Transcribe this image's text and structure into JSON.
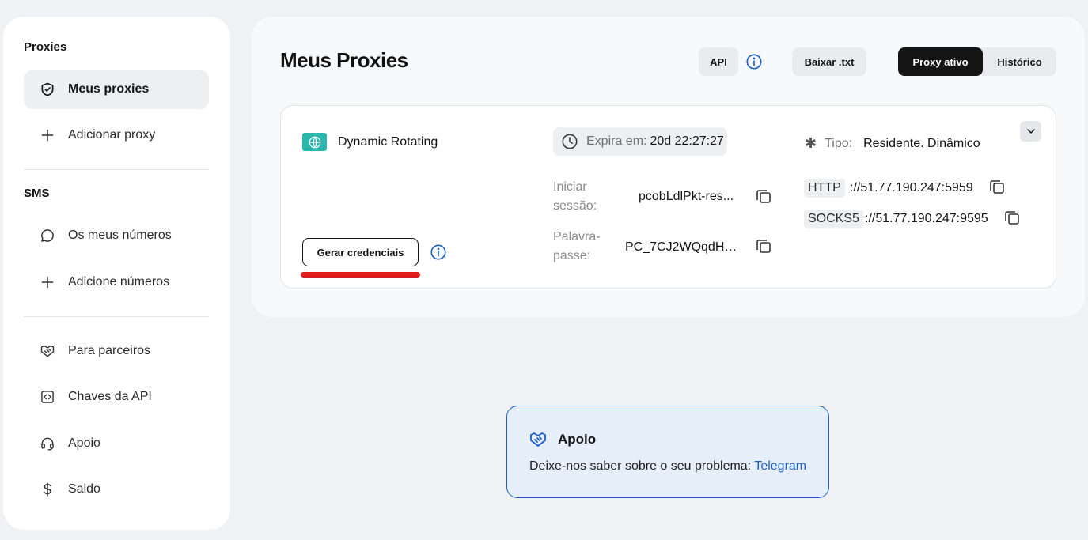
{
  "sidebar": {
    "proxies_title": "Proxies",
    "sms_title": "SMS",
    "items": [
      {
        "label": "Meus proxies",
        "icon": "shield-check-icon"
      },
      {
        "label": "Adicionar proxy",
        "icon": "plus-icon"
      },
      {
        "label": "Os meus números",
        "icon": "chat-bubble-icon"
      },
      {
        "label": "Adicione números",
        "icon": "plus-icon"
      },
      {
        "label": "Para parceiros",
        "icon": "handshake-icon"
      },
      {
        "label": "Chaves da API",
        "icon": "code-box-icon"
      },
      {
        "label": "Apoio",
        "icon": "headset-icon"
      },
      {
        "label": "Saldo",
        "icon": "dollar-icon"
      }
    ]
  },
  "header": {
    "title": "Meus Proxies",
    "api_label": "API",
    "download_label": "Baixar .txt",
    "toggle": [
      "Proxy ativo",
      "Histórico"
    ]
  },
  "proxy_card": {
    "name": "Dynamic Rotating",
    "expire_label": "Expira em:",
    "expire_value": "20d 22:27:27",
    "type_label": "Tipo:",
    "type_value": "Residente. Dinâmico",
    "login_label_1": "Iniciar",
    "login_label_2": "sessão:",
    "login_value": "pcobLdlPkt-res...",
    "password_label_1": "Palavra-",
    "password_label_2": "passe:",
    "password_value": "PC_7CJ2WQqdHN...",
    "http_tag": "HTTP",
    "http_addr": "://51.77.190.247:5959",
    "socks_tag": "SOCKS5",
    "socks_addr": "://51.77.190.247:9595",
    "generate_label": "Gerar credenciais"
  },
  "support": {
    "title": "Apoio",
    "text": "Deixe-nos saber sobre o seu problema:",
    "link": "Telegram"
  },
  "colors": {
    "accent_blue": "#1c5fc4",
    "teal": "#2bb6ae",
    "highlight_red": "#e01b1b"
  }
}
